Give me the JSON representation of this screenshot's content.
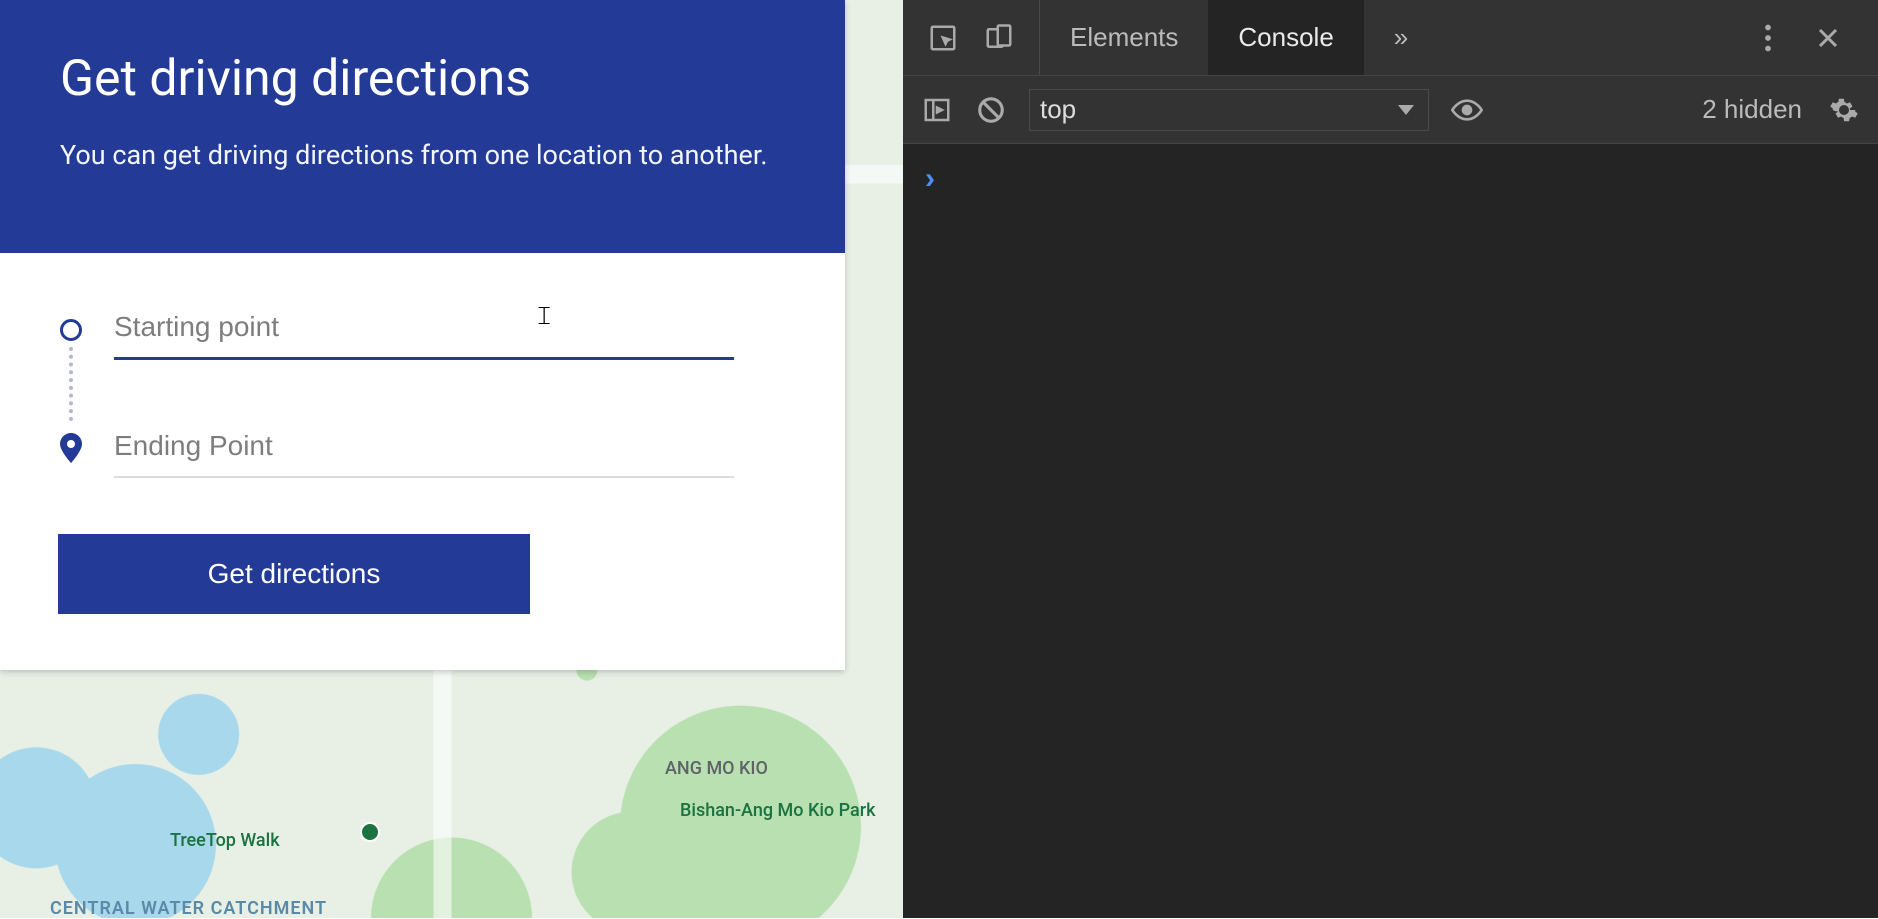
{
  "left": {
    "header": {
      "title": "Get driving directions",
      "subtitle": "You can get driving directions from one location to another."
    },
    "inputs": {
      "start_placeholder": "Starting point",
      "end_placeholder": "Ending Point"
    },
    "button_label": "Get directions",
    "map_labels": {
      "ang_mo_kio": "ANG MO KIO",
      "bishan_park": "Bishan-Ang Mo Kio Park",
      "treetop": "TreeTop Walk",
      "central_water": "CENTRAL WATER CATCHMENT"
    }
  },
  "devtools": {
    "tabs": {
      "elements": "Elements",
      "console": "Console",
      "more": "»"
    },
    "toolbar": {
      "context": "top",
      "hidden": "2 hidden"
    },
    "prompt": "›"
  }
}
